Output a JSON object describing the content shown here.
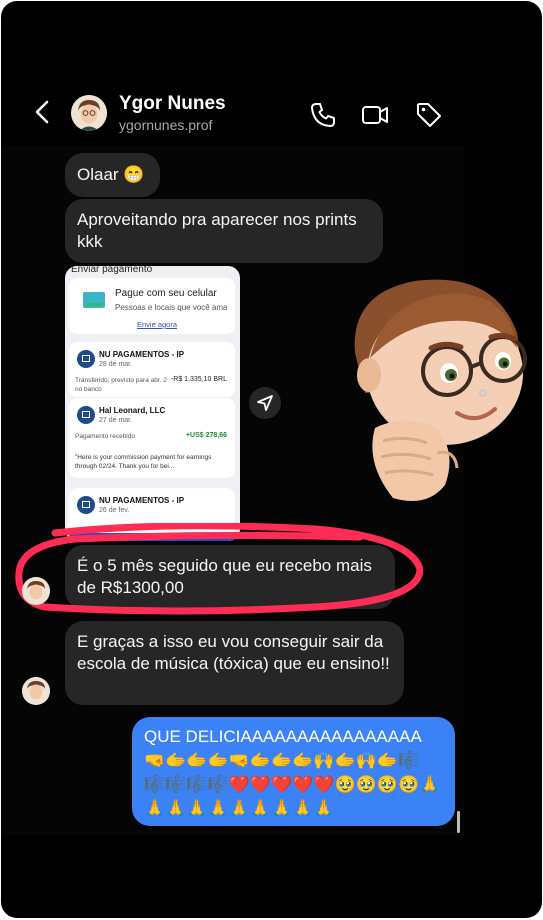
{
  "header": {
    "name": "Ygor Nunes",
    "username": "ygornunes.prof"
  },
  "messages": [
    {
      "from": "contact",
      "text": "Olaar 😁"
    },
    {
      "from": "contact",
      "text": "Aproveitando pra aparecer nos prints kkk"
    },
    {
      "from": "contact",
      "text": "É o 5 mês seguido que eu recebo mais de R$1300,00"
    },
    {
      "from": "contact",
      "text": "E graças a isso eu vou conseguir sair da escola de música (tóxica) que eu ensino!!"
    },
    {
      "from": "me",
      "text": "QUE DELICIAAAAAAAAAAAAAAAA 🤜🫱🫱🫱🤜🫱🫱🫱🙌🫱🙌🫱🎼🎼🎼🎼🎼❤️❤️❤️❤️❤️🥹🥹🥹🥹🙏🙏🙏🙏🙏🙏🙏🙏🙏🙏"
    }
  ],
  "payment_screenshot": {
    "header": "Enviar pagamento",
    "box_title": "Pague com seu celular",
    "box_sub": "Pessoas e locais que você ama",
    "box_link": "Envie agora",
    "transactions": [
      {
        "name": "NU PAGAMENTOS - IP",
        "date": "28 de mar.",
        "desc": "Transferido, previsto para abr. 2 no banco",
        "amount": "-R$ 1.335,10 BRL"
      },
      {
        "name": "Hal Leonard, LLC",
        "date": "27 de mar.",
        "desc": "Pagamento recebido",
        "amount": "+US$ 278,66",
        "note": "\"Here is your commission payment for earnings through 02/24. Thank you for bei..."
      },
      {
        "name": "NU PAGAMENTOS - IP",
        "date": "26 de fev."
      }
    ]
  },
  "colors": {
    "background": "#000000",
    "bubble_received": "#262626",
    "bubble_sent": "#3b82f6",
    "annotation": "#ff2d55"
  },
  "icons": {
    "back": "chevron-left-icon",
    "call": "phone-icon",
    "video": "video-camera-icon",
    "tag": "tag-icon",
    "share": "share-arrow-icon"
  }
}
